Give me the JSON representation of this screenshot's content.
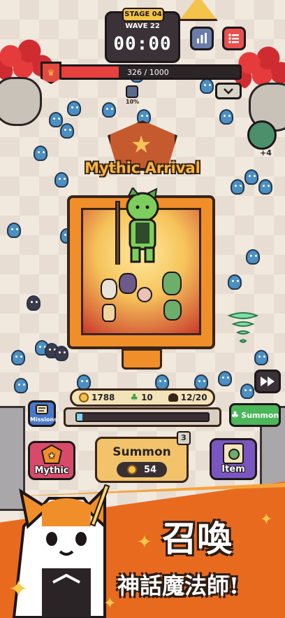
{
  "hud": {
    "stage": "STAGE 04",
    "wave": "WAVE 22",
    "timer": "00:00",
    "boss_hp": "326 / 1000",
    "boss_hp_fraction": 0.326,
    "buff_pct": "10%",
    "stats_icon": "bar-chart-icon",
    "menu_icon": "list-icon",
    "collapse_icon": "chevron-down-icon",
    "side_reward": "+4"
  },
  "mythic": {
    "title": "Mythic Arrival"
  },
  "resources": {
    "coins": "1788",
    "clovers": "10",
    "units": "12/20",
    "summon_progress_fraction": 0.04
  },
  "buttons": {
    "fast_forward_icon": "fast-forward-icon",
    "missions": "Missions",
    "summon_small": "Summon",
    "mythic": "Mythic",
    "summon": "Summon",
    "summon_cost": "54",
    "summon_count": "3",
    "item": "Item"
  },
  "promo": {
    "line1": "召喚",
    "line2": "神話魔法師!"
  },
  "colors": {
    "accent_orange": "#e86a1f",
    "hp_red": "#e8403e",
    "missions_blue": "#4a78c8",
    "summon_green": "#4cb65a",
    "mythic_pink": "#d94a6a",
    "item_purple": "#7a56c0"
  }
}
